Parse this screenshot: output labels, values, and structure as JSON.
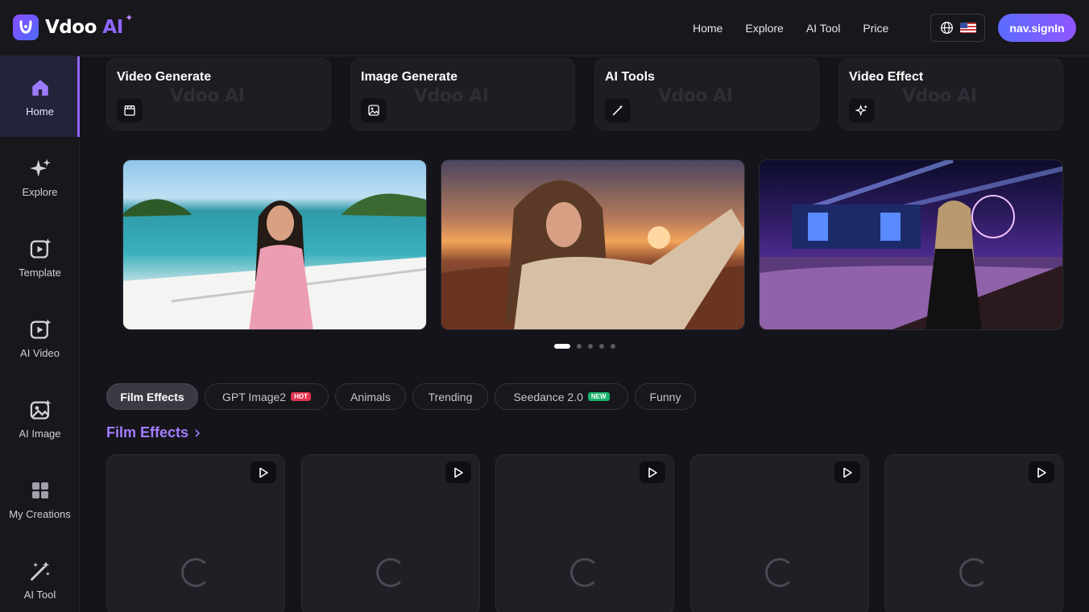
{
  "brand": {
    "name": "Vdoo",
    "name_ai": "AI"
  },
  "nav": {
    "links": [
      "Home",
      "Explore",
      "AI Tool",
      "Price"
    ],
    "signin_label": "nav.signIn",
    "lang_icon": "globe-icon",
    "flag": "us-flag"
  },
  "sidebar": {
    "items": [
      {
        "label": "Home",
        "icon": "home-icon",
        "active": true
      },
      {
        "label": "Explore",
        "icon": "sparkle-icon"
      },
      {
        "label": "Template",
        "icon": "template-icon"
      },
      {
        "label": "AI Video",
        "icon": "ai-video-icon"
      },
      {
        "label": "AI Image",
        "icon": "ai-image-icon"
      },
      {
        "label": "My Creations",
        "icon": "grid-icon"
      },
      {
        "label": "AI Tool",
        "icon": "magic-wand-icon"
      }
    ]
  },
  "tools": {
    "cards": [
      {
        "title": "Video Generate",
        "icon": "clapperboard-icon"
      },
      {
        "title": "Image Generate",
        "icon": "image-icon"
      },
      {
        "title": "AI Tools",
        "icon": "magic-wand-icon"
      },
      {
        "title": "Video Effect",
        "icon": "sparkles-icon"
      }
    ],
    "watermark": "Vdoo AI"
  },
  "carousel": {
    "slides": [
      "woman-on-boat",
      "woman-at-sunset",
      "woman-at-concert"
    ],
    "dot_count": 5,
    "active_dot": 0
  },
  "categories": {
    "pills": [
      {
        "label": "Film Effects",
        "active": true
      },
      {
        "label": "GPT Image2",
        "badge": "HOT"
      },
      {
        "label": "Animals"
      },
      {
        "label": "Trending"
      },
      {
        "label": "Seedance 2.0",
        "badge": "NEW"
      },
      {
        "label": "Funny"
      }
    ]
  },
  "section": {
    "title": "Film Effects",
    "chevron": "chevron-right-icon"
  },
  "colors": {
    "accent": "#8e66ff",
    "hot": "#e5334f",
    "new": "#18b26b",
    "bg": "#14141a"
  }
}
